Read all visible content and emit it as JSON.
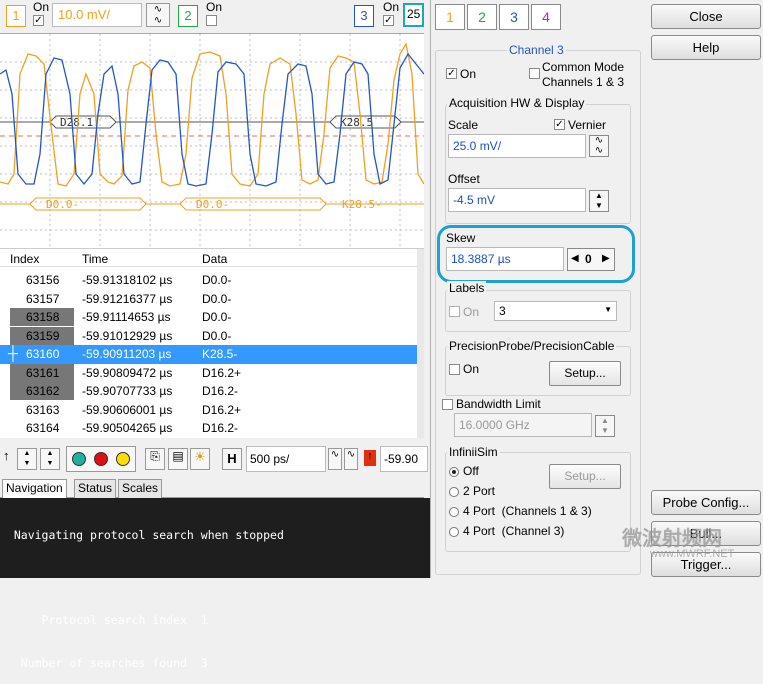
{
  "toolbar": {
    "ch1_label": "1",
    "ch1_on_label": "On",
    "ch1_scale": "10.0 mV/",
    "ch2_label": "2",
    "ch2_on_label": "On",
    "ch3_label": "3",
    "ch3_on_label": "On",
    "ch3_partial": "25"
  },
  "scope": {
    "labels_top": [
      "D28.1",
      "K28.5"
    ],
    "labels_bottom": [
      "D0.0-",
      "D0.0-",
      "K28.5-"
    ],
    "colors": {
      "ch3": "#2255cc",
      "ch1": "#f0a020",
      "grid": "#b8b8b8",
      "ref": "#e07050"
    }
  },
  "table": {
    "headers": {
      "index": "Index",
      "time": "Time",
      "data": "Data"
    },
    "rows": [
      {
        "index": "63156",
        "time": "-59.91318102 µs",
        "data": "D0.0-"
      },
      {
        "index": "63157",
        "time": "-59.91216377 µs",
        "data": "D0.0-"
      },
      {
        "index": "63158",
        "time": "-59.91114653 µs",
        "data": "D0.0-"
      },
      {
        "index": "63159",
        "time": "-59.91012929 µs",
        "data": "D0.0-"
      },
      {
        "index": "63160",
        "time": "-59.90911203 µs",
        "data": "K28.5-"
      },
      {
        "index": "63161",
        "time": "-59.90809472 µs",
        "data": "D16.2+"
      },
      {
        "index": "63162",
        "time": "-59.90707733 µs",
        "data": "D16.2-"
      },
      {
        "index": "63163",
        "time": "-59.90606001 µs",
        "data": "D16.2+"
      },
      {
        "index": "63164",
        "time": "-59.90504265 µs",
        "data": "D16.2-"
      }
    ]
  },
  "controls": {
    "h_label": "H",
    "timebase": "500 ps/",
    "partial_value": "-59.90"
  },
  "tabs": [
    "Navigation",
    "Status",
    "Scales"
  ],
  "console_lines": [
    "  Navigating protocol search when stopped",
    "",
    "      Protocol search index  1",
    "   Number of searches found  3"
  ],
  "panel": {
    "tabs": [
      "1",
      "2",
      "3",
      "4"
    ],
    "channel_title": "Channel 3",
    "on_label": "On",
    "common_mode_label": "Common Mode",
    "common_mode_sub": "Channels 1 & 3",
    "acq_title": "Acquisition HW & Display",
    "scale_label": "Scale",
    "vernier_label": "Vernier",
    "scale_value": "25.0 mV/",
    "offset_label": "Offset",
    "offset_value": "-4.5 mV",
    "skew_label": "Skew",
    "skew_value": "18.3887 µs",
    "skew_zero": "0",
    "labels_title": "Labels",
    "labels_on": "On",
    "labels_select": "3",
    "probe_title": "PrecisionProbe/PrecisionCable",
    "probe_on": "On",
    "setup_label": "Setup...",
    "bw_label": "Bandwidth Limit",
    "bw_value": "16.0000 GHz",
    "infinisim_title": "InfiniiSim",
    "radio_off": "Off",
    "radio_2port": "2 Port",
    "radio_4port_a": "4 Port  (Channels 1 & 3)",
    "radio_4port_b": "4 Port  (Channel 3)",
    "setup2_label": "Setup..."
  },
  "side": {
    "close": "Close",
    "help": "Help",
    "probe_config": "Probe Config...",
    "partial_btn": "Bull...",
    "trigger": "Trigger..."
  },
  "watermark": {
    "cn": "微波射频网",
    "url": "www.MWRF.NET"
  }
}
